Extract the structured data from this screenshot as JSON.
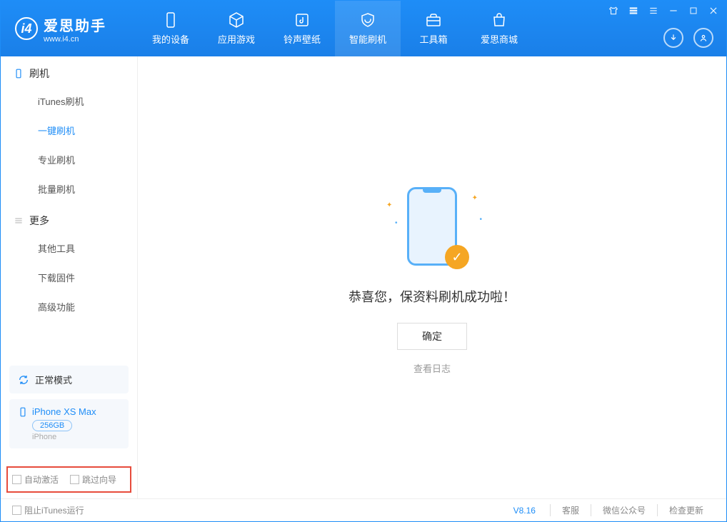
{
  "app": {
    "title": "爱思助手",
    "url": "www.i4.cn"
  },
  "nav": {
    "tabs": [
      {
        "label": "我的设备"
      },
      {
        "label": "应用游戏"
      },
      {
        "label": "铃声壁纸"
      },
      {
        "label": "智能刷机"
      },
      {
        "label": "工具箱"
      },
      {
        "label": "爱思商城"
      }
    ]
  },
  "sidebar": {
    "sections": [
      {
        "title": "刷机",
        "items": [
          "iTunes刷机",
          "一键刷机",
          "专业刷机",
          "批量刷机"
        ]
      },
      {
        "title": "更多",
        "items": [
          "其他工具",
          "下载固件",
          "高级功能"
        ]
      }
    ],
    "mode_label": "正常模式",
    "device": {
      "name": "iPhone XS Max",
      "storage": "256GB",
      "type": "iPhone"
    },
    "checks": {
      "auto_activate": "自动激活",
      "skip_guide": "跳过向导"
    }
  },
  "main": {
    "success_message": "恭喜您，保资料刷机成功啦！",
    "ok_button": "确定",
    "view_log": "查看日志"
  },
  "statusbar": {
    "prevent_itunes": "阻止iTunes运行",
    "version": "V8.16",
    "links": [
      "客服",
      "微信公众号",
      "检查更新"
    ]
  }
}
